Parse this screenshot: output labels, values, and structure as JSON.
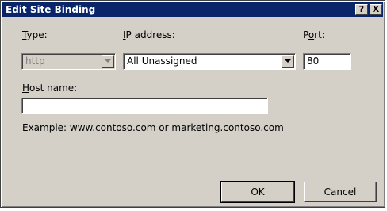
{
  "window": {
    "title": "Edit Site Binding",
    "help_glyph": "?",
    "close_glyph": "X"
  },
  "type": {
    "label_prefix": "",
    "label_accel": "T",
    "label_rest": "ype:",
    "value": "http"
  },
  "ip": {
    "label_prefix": "",
    "label_accel": "I",
    "label_rest": "P address:",
    "value": "All Unassigned"
  },
  "port": {
    "label_prefix": "P",
    "label_accel": "o",
    "label_rest": "rt:",
    "value": "80"
  },
  "host": {
    "label_prefix": "",
    "label_accel": "H",
    "label_rest": "ost name:",
    "value": "",
    "example": "Example: www.contoso.com or marketing.contoso.com"
  },
  "buttons": {
    "ok": "OK",
    "cancel": "Cancel"
  }
}
